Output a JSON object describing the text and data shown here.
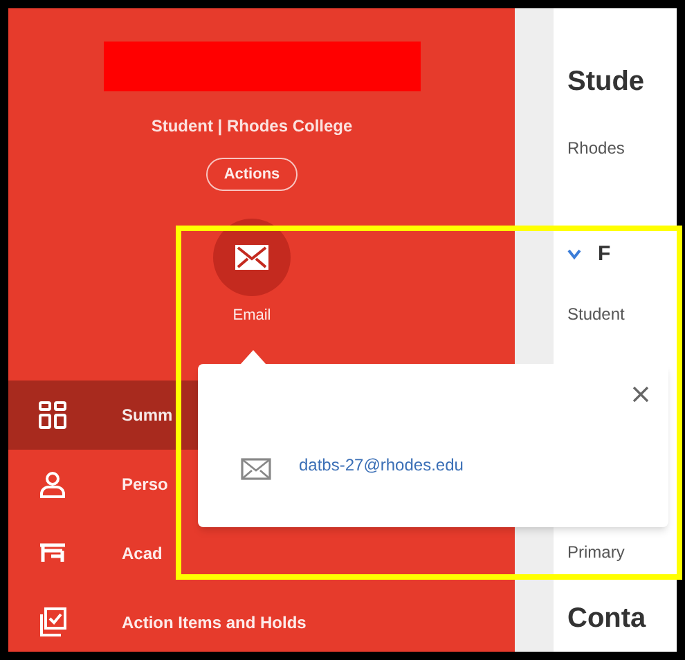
{
  "profile": {
    "subtitle": "Student | Rhodes College",
    "actions_button": "Actions",
    "quick_action": {
      "label": "Email"
    }
  },
  "nav": [
    {
      "label": "Summ",
      "kind": "grid",
      "selected": true
    },
    {
      "label": "Perso",
      "kind": "person",
      "selected": false
    },
    {
      "label": "Acad",
      "kind": "academics",
      "selected": false
    },
    {
      "label": "Action Items and Holds",
      "kind": "checklist",
      "selected": false
    }
  ],
  "content": {
    "heading": "Stude",
    "lines": [
      {
        "kind": "text",
        "text": "Rhodes"
      },
      {
        "kind": "section",
        "text": "F"
      },
      {
        "kind": "text",
        "text": "Student"
      },
      {
        "kind": "gap"
      },
      {
        "kind": "text",
        "text": "Primary"
      }
    ],
    "section_heading": "Conta"
  },
  "popup": {
    "email": "datbs-27@rhodes.edu"
  }
}
